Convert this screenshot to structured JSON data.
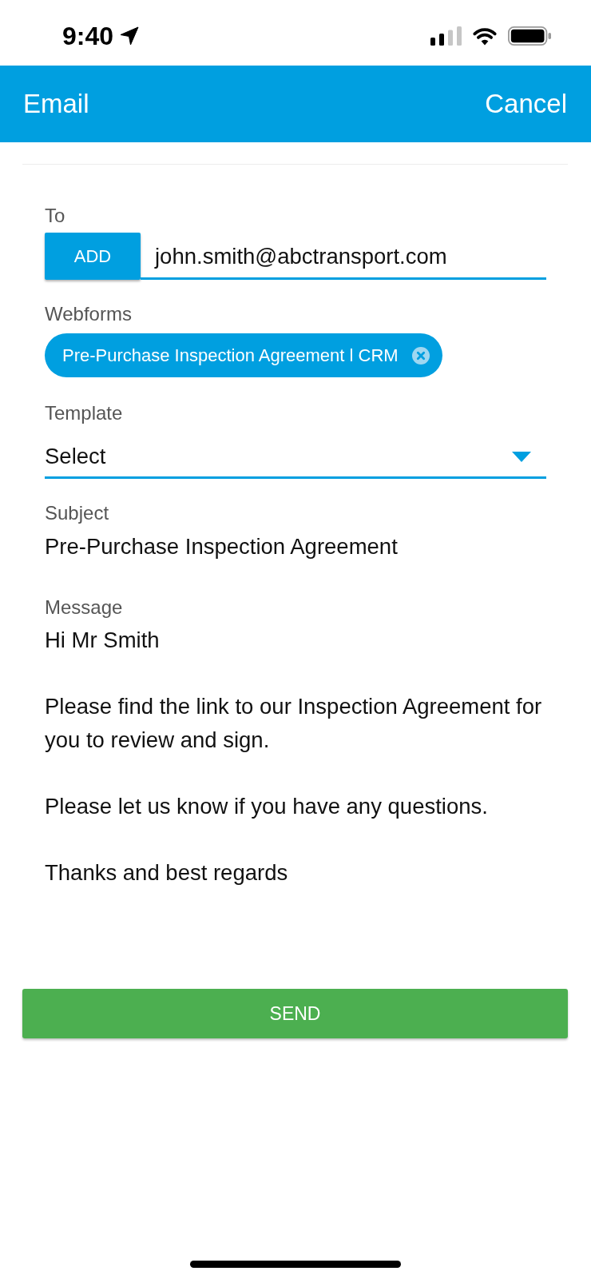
{
  "status_bar": {
    "time": "9:40"
  },
  "header": {
    "title": "Email",
    "cancel": "Cancel"
  },
  "form": {
    "to": {
      "label": "To",
      "add_button": "ADD",
      "value": "john.smith@abctransport.com"
    },
    "webforms": {
      "label": "Webforms",
      "chips": [
        {
          "label": "Pre-Purchase Inspection Agreement l CRM"
        }
      ]
    },
    "template": {
      "label": "Template",
      "value": "Select"
    },
    "subject": {
      "label": "Subject",
      "value": "Pre-Purchase Inspection Agreement"
    },
    "message": {
      "label": "Message",
      "value": "Hi Mr Smith\n\nPlease find the link to our Inspection Agreement for you to review and sign.\n\nPlease let us know if you have any questions.\n\nThanks and best regards"
    }
  },
  "send_button": "SEND"
}
